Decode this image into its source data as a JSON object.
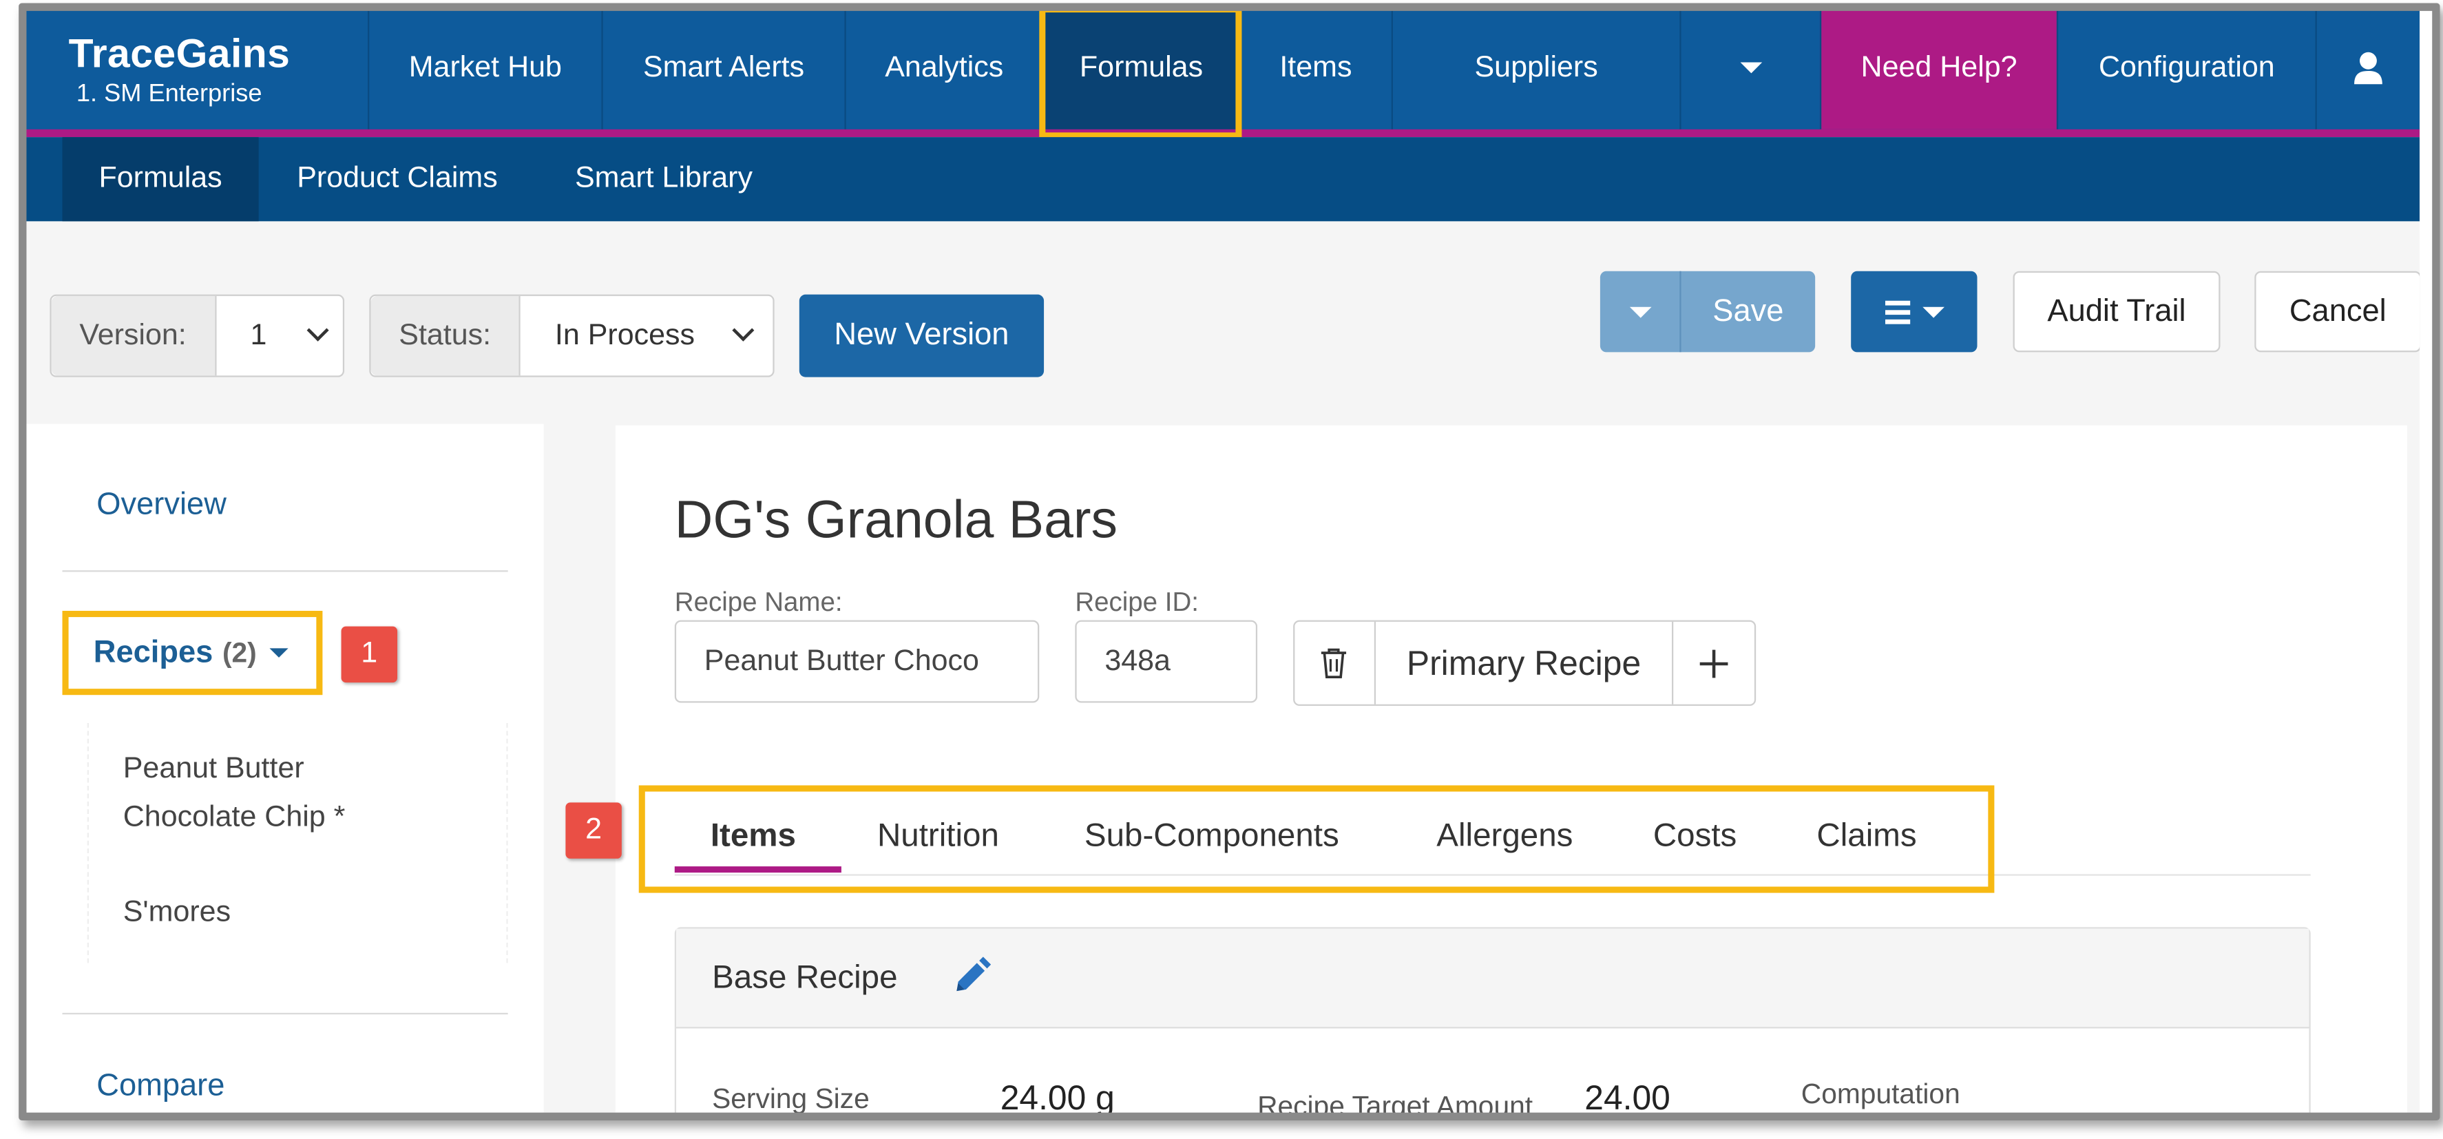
{
  "brand": {
    "name": "TraceGains",
    "subtitle": "1. SM Enterprise"
  },
  "topnav": {
    "items": [
      "Market Hub",
      "Smart Alerts",
      "Analytics",
      "Formulas",
      "Items",
      "Suppliers"
    ],
    "active": "Formulas",
    "help": "Need Help?",
    "configuration": "Configuration"
  },
  "subnav": {
    "items": [
      "Formulas",
      "Product Claims",
      "Smart Library"
    ],
    "active": "Formulas"
  },
  "toolbar": {
    "version_label": "Version:",
    "version_value": "1",
    "status_label": "Status:",
    "status_value": "In Process",
    "new_version": "New Version",
    "save": "Save",
    "audit_trail": "Audit Trail",
    "cancel": "Cancel"
  },
  "sidebar": {
    "overview": "Overview",
    "recipes_label": "Recipes",
    "recipes_count": "(2)",
    "recipes": [
      "Peanut Butter Chocolate Chip *",
      "S'mores"
    ],
    "compare": "Compare"
  },
  "badges": {
    "one": "1",
    "two": "2"
  },
  "main": {
    "title": "DG's Granola Bars",
    "recipe_name_label": "Recipe Name:",
    "recipe_name_value": "Peanut Butter Choco",
    "recipe_id_label": "Recipe ID:",
    "recipe_id_value": "348a",
    "recipe_selector": "Primary Recipe",
    "tabs": [
      "Items",
      "Nutrition",
      "Sub-Components",
      "Allergens",
      "Costs",
      "Claims"
    ],
    "active_tab": "Items",
    "base_recipe": {
      "title": "Base Recipe",
      "serving_size_label": "Serving Size",
      "serving_size_value": "24.00 g",
      "target_amount_label": "Recipe Target Amount",
      "target_amount_value": "24.00",
      "computation_label": "Computation"
    }
  },
  "colors": {
    "nav": "#0e5b9c",
    "subnav": "#064d85",
    "accent": "#ad1a85",
    "highlight": "#f7b913",
    "primary_button": "#1c67a6",
    "badge": "#ea4f45"
  },
  "icons": [
    "chevron-down-icon",
    "user-icon",
    "trash-icon",
    "plus-icon",
    "pencil-icon",
    "hamburger-menu-icon",
    "caret-down-icon"
  ]
}
